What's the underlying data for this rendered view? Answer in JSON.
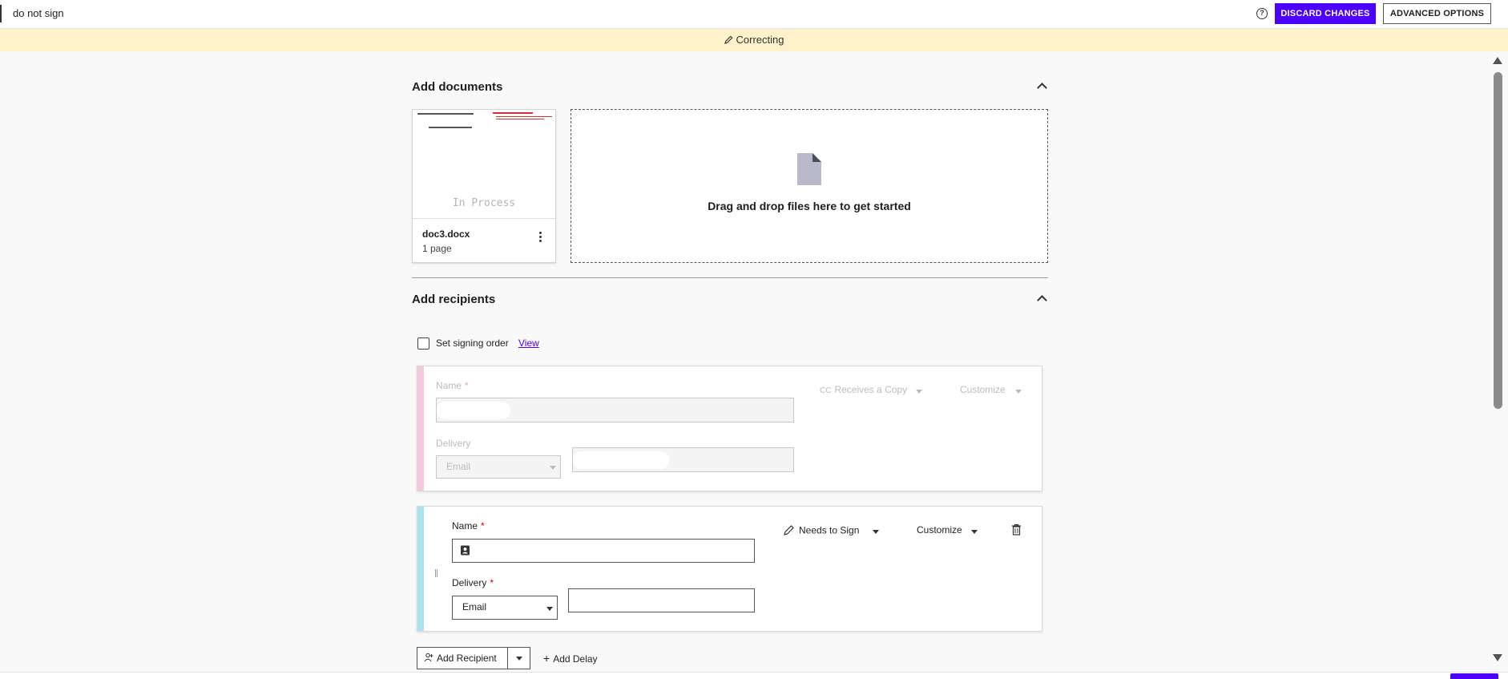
{
  "header": {
    "envelope_title": "do not sign",
    "help_icon": "?",
    "discard_label": "DISCARD CHANGES",
    "advanced_label": "ADVANCED OPTIONS"
  },
  "banner": {
    "text": "Correcting"
  },
  "documents": {
    "section_title": "Add documents",
    "items": [
      {
        "name": "doc3.docx",
        "pages": "1 page",
        "watermark": "In Process"
      }
    ],
    "dropzone_text": "Drag and drop files here to get started"
  },
  "recipients": {
    "section_title": "Add recipients",
    "signing_order_label": "Set signing order",
    "view_link": "View",
    "list": [
      {
        "name_label": "Name",
        "name_required": "*",
        "delivery_label": "Delivery",
        "delivery_value": "Email",
        "role": "Receives a Copy",
        "role_icon": "CC",
        "customize": "Customize",
        "stripe_color": "#f7c6df",
        "disabled": true
      },
      {
        "name_label": "Name",
        "name_required": "*",
        "delivery_label": "Delivery",
        "delivery_required": "*",
        "delivery_value": "Email",
        "role": "Needs to Sign",
        "customize": "Customize",
        "stripe_color": "#a9e4f2",
        "disabled": false
      }
    ],
    "add_recipient_label": "Add Recipient",
    "add_delay_label": "Add Delay"
  },
  "colors": {
    "accent": "#4c00ff",
    "banner_bg": "#fdf2c9"
  }
}
